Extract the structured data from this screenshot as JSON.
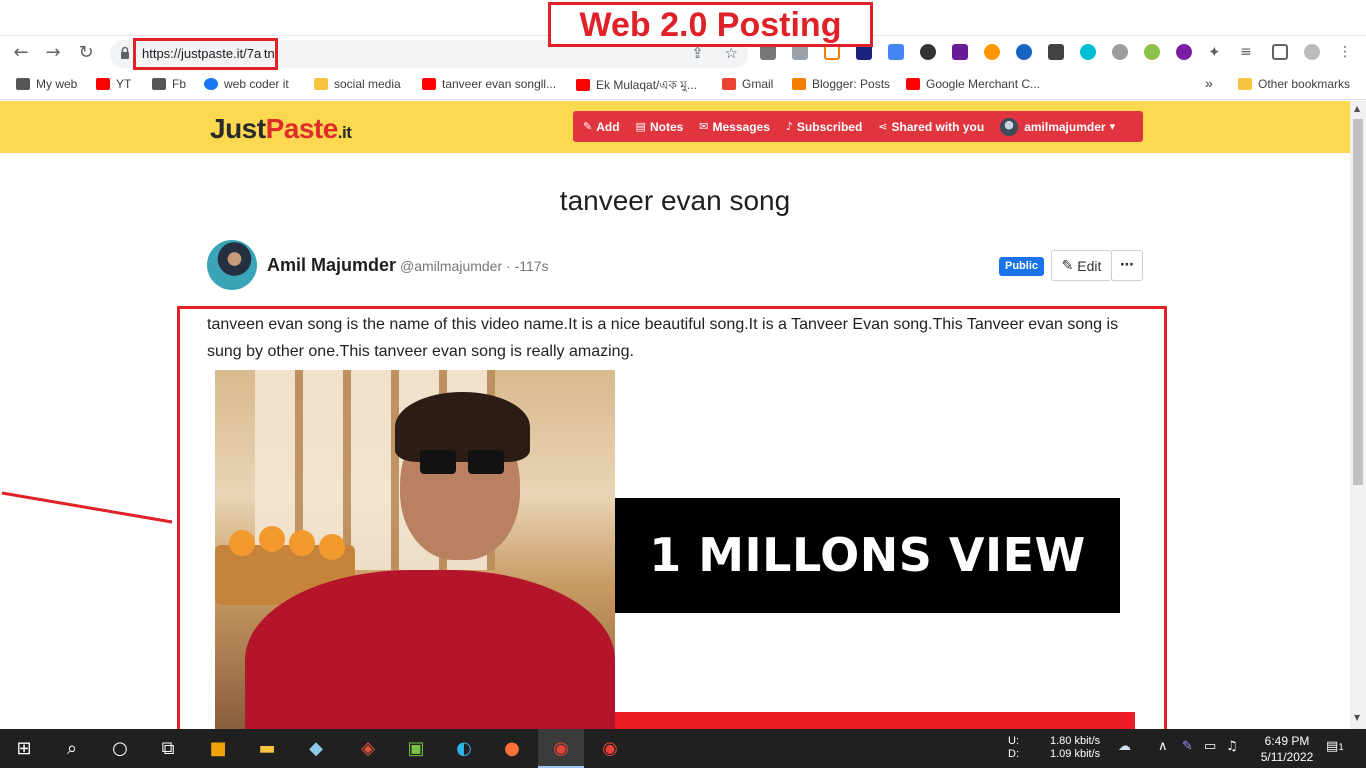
{
  "annotation": {
    "title": "Web 2.0 Posting"
  },
  "browser": {
    "url": "https://justpaste.it/7a tn",
    "bookmarks": [
      {
        "label": "My web",
        "color": "#555"
      },
      {
        "label": "YT",
        "color": "#ff0000"
      },
      {
        "label": "Fb",
        "color": "#555"
      },
      {
        "label": "web coder it",
        "color": "#1877f2"
      },
      {
        "label": "social media",
        "color": "#f5c542"
      },
      {
        "label": "tanveer evan songll...",
        "color": "#ff0000"
      },
      {
        "label": "Ek Mulaqat/এক মু...",
        "color": "#ff0000"
      },
      {
        "label": "Gmail",
        "color": "#ea4335"
      },
      {
        "label": "Blogger: Posts",
        "color": "#f57d00"
      },
      {
        "label": "Google Merchant C...",
        "color": "#ff0000"
      }
    ],
    "more_bookmarks": "»",
    "other_bookmarks": "Other bookmarks"
  },
  "site": {
    "logo_just": "Just",
    "logo_paste": "Paste",
    "logo_it": ".it",
    "menu": {
      "add": "Add",
      "notes": "Notes",
      "messages": "Messages",
      "subscribed": "Subscribed",
      "shared": "Shared with you",
      "user": "amilmajumder"
    }
  },
  "post": {
    "title": "tanveer evan song",
    "author_name": "Amil Majumder",
    "author_meta": "@amilmajumder · -117s",
    "visibility": "Public",
    "edit_label": "Edit",
    "more_label": "⋯",
    "body": "tanveen evan song is the name of this video name.It is a nice beautiful song.It is a Tanveer Evan song.This Tanveer evan song is sung by other one.This tanveer evan song is really amazing.",
    "image_caption": "1 MILLONS VIEW"
  },
  "taskbar": {
    "net_labels": "U:\nD:",
    "net_up": "1.80 kbit/s",
    "net_down": "1.09 kbit/s",
    "time": "6:49 PM",
    "date": "5/11/2022",
    "notifications": "1"
  }
}
